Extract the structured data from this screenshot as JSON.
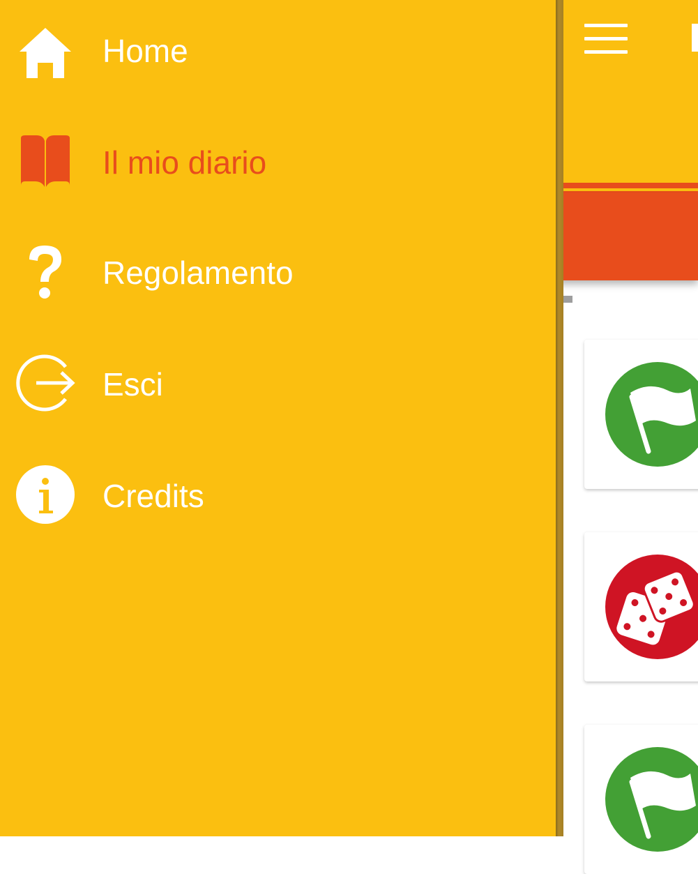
{
  "menu": {
    "items": [
      {
        "label": "Home",
        "icon": "home-icon",
        "active": false
      },
      {
        "label": "Il mio diario",
        "icon": "book-icon",
        "active": true
      },
      {
        "label": "Regolamento",
        "icon": "question-mark-icon",
        "active": false
      },
      {
        "label": "Esci",
        "icon": "logout-icon",
        "active": false
      },
      {
        "label": "Credits",
        "icon": "info-icon",
        "active": false
      }
    ]
  },
  "colors": {
    "primary": "#fbbf10",
    "accent": "#e84d1c",
    "text_on_primary": "#ffffff",
    "card_green": "#43a035",
    "card_red": "#cf1424"
  },
  "cards": [
    {
      "icon": "flag-icon",
      "color": "#43a035"
    },
    {
      "icon": "dice-icon",
      "color": "#cf1424"
    },
    {
      "icon": "flag-icon",
      "color": "#43a035"
    }
  ]
}
